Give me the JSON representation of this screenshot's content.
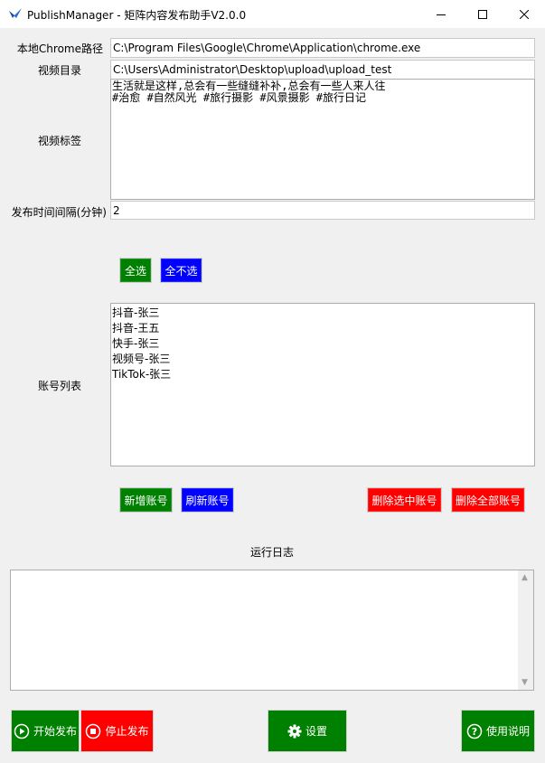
{
  "window": {
    "title": "PublishManager - 矩阵内容发布助手V2.0.0",
    "icons": [
      "app-icon",
      "minimize-icon",
      "maximize-icon",
      "close-icon"
    ]
  },
  "form": {
    "chrome_label": "本地Chrome路径",
    "chrome_value": "C:\\Program Files\\Google\\Chrome\\Application\\chrome.exe",
    "video_dir_label": "视频目录",
    "video_dir_value": "C:\\Users\\Administrator\\Desktop\\upload\\upload_test",
    "tags_label": "视频标签",
    "tags_value": "生活就是这样,总会有一些缝缝补补,总会有一些人来人往\n#治愈 #自然风光 #旅行摄影 #风景摄影 #旅行日记",
    "interval_label": "发布时间间隔(分钟)",
    "interval_value": "2"
  },
  "selection": {
    "select_all": "全选",
    "select_none": "全不选"
  },
  "accounts": {
    "label": "账号列表",
    "items": [
      "抖音-张三",
      "抖音-王五",
      "快手-张三",
      "视频号-张三",
      "TikTok-张三"
    ],
    "add_button": "新增账号",
    "refresh_button": "刷新账号",
    "delete_selected_button": "删除选中账号",
    "delete_all_button": "删除全部账号"
  },
  "log": {
    "label": "运行日志",
    "content": ""
  },
  "actions": {
    "start": "开始发布",
    "stop": "停止发布",
    "settings": "设置",
    "help": "使用说明"
  },
  "colors": {
    "green": "#008000",
    "blue": "#0000ff",
    "red": "#ff0000"
  }
}
